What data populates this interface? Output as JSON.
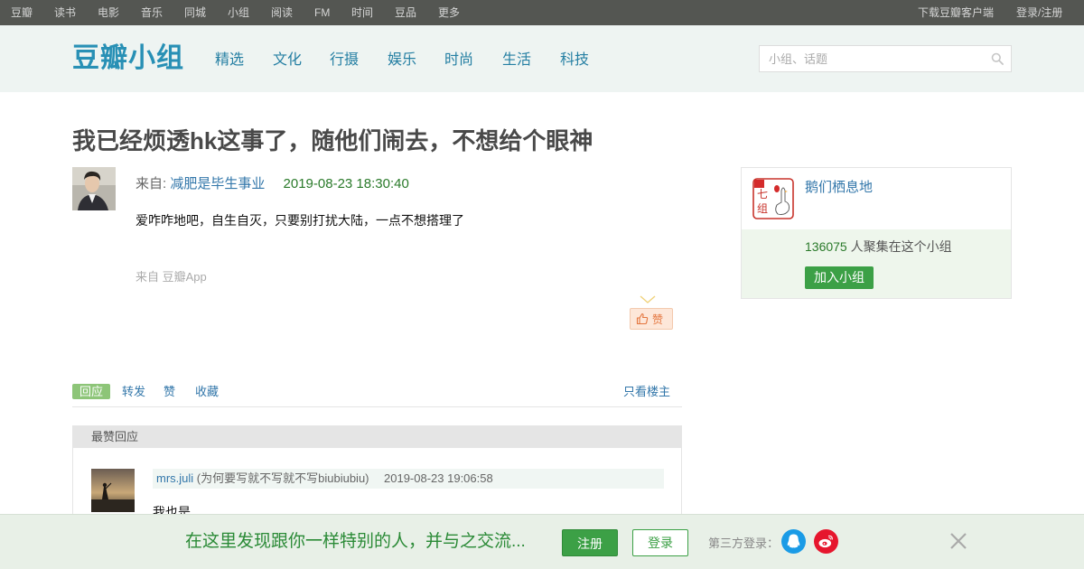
{
  "topnav": {
    "left": [
      "豆瓣",
      "读书",
      "电影",
      "音乐",
      "同城",
      "小组",
      "阅读",
      "FM",
      "时间",
      "豆品",
      "更多"
    ],
    "download": "下载豆瓣客户端",
    "login_register": "登录/注册"
  },
  "header": {
    "logo": "豆瓣小组",
    "nav": [
      "精选",
      "文化",
      "行摄",
      "娱乐",
      "时尚",
      "生活",
      "科技"
    ],
    "search_placeholder": "小组、话题"
  },
  "topic": {
    "title": "我已经烦透hk这事了，随他们闹去，不想给个眼神",
    "from_label": "来自:",
    "author": "减肥是毕生事业",
    "time": "2019-08-23 18:30:40",
    "content": "爱咋咋地吧，自生自灭，只要别打扰大陆，一点不想搭理了",
    "source": "来自 豆瓣App",
    "like_label": "赞"
  },
  "actions": {
    "reply": "回应",
    "forward": "转发",
    "like": "赞",
    "collect": "收藏",
    "only_op": "只看楼主"
  },
  "hot_replies": {
    "header": "最赞回应",
    "items": [
      {
        "name": "mrs.juli",
        "signature": "(为何要写就不写就不写biubiubiu)",
        "time": "2019-08-23 19:06:58",
        "text": "我也是"
      }
    ]
  },
  "group": {
    "name": "鹅们栖息地",
    "member_count": "136075",
    "member_text": " 人聚集在这个小组",
    "join_label": "加入小组",
    "icon_chars": [
      "七",
      "组"
    ]
  },
  "bottombar": {
    "slogan": "在这里发现跟你一样特别的人，并与之交流...",
    "signup": "注册",
    "login": "登录",
    "third_party": "第三方登录："
  },
  "colors": {
    "topnav_bg": "#545652",
    "header_bg": "#eef4f2",
    "link": "#3377aa",
    "green": "#3ca046",
    "time_green": "#2a7a2a"
  },
  "icons": [
    "search-icon",
    "thumbs-up-icon",
    "qq-icon",
    "weibo-icon",
    "close-icon"
  ]
}
